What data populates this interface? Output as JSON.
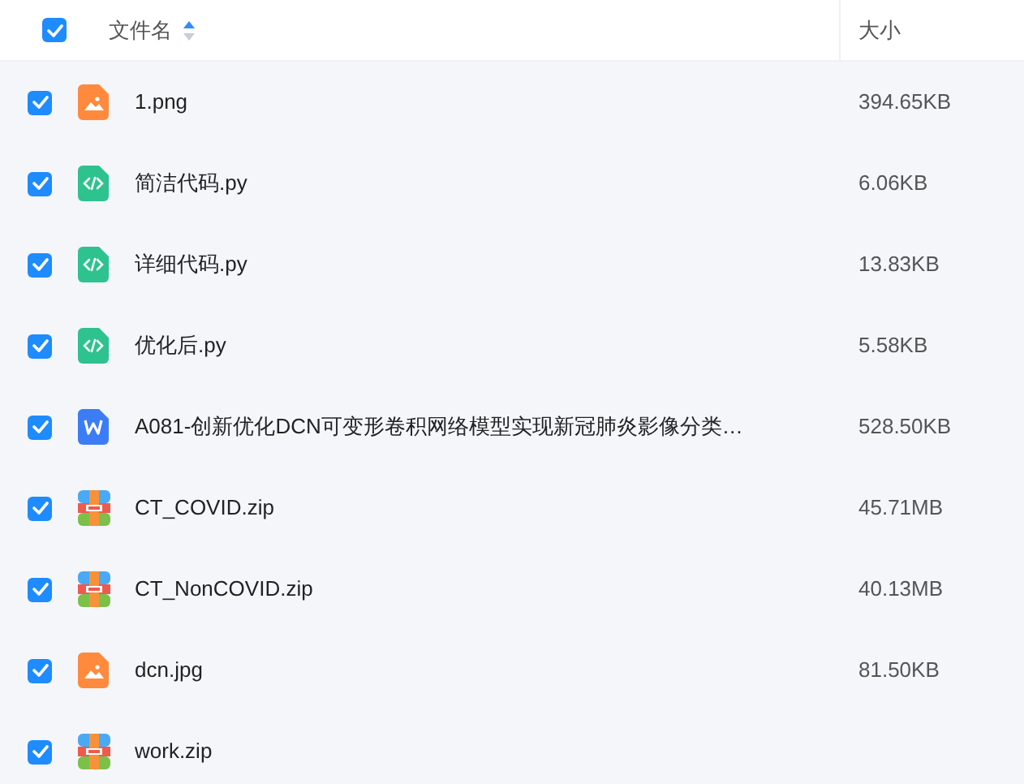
{
  "header": {
    "select_all_checked": true,
    "name_column": "文件名",
    "size_column": "大小"
  },
  "files": [
    {
      "name": "1.png",
      "size": "394.65KB",
      "kind": "image",
      "checked": true
    },
    {
      "name": "简洁代码.py",
      "size": "6.06KB",
      "kind": "code",
      "checked": true
    },
    {
      "name": "详细代码.py",
      "size": "13.83KB",
      "kind": "code",
      "checked": true
    },
    {
      "name": "优化后.py",
      "size": "5.58KB",
      "kind": "code",
      "checked": true
    },
    {
      "name": "A081-创新优化DCN可变形卷积网络模型实现新冠肺炎影像分类…",
      "size": "528.50KB",
      "kind": "doc",
      "checked": true
    },
    {
      "name": "CT_COVID.zip",
      "size": "45.71MB",
      "kind": "zip",
      "checked": true
    },
    {
      "name": "CT_NonCOVID.zip",
      "size": "40.13MB",
      "kind": "zip",
      "checked": true
    },
    {
      "name": "dcn.jpg",
      "size": "81.50KB",
      "kind": "image",
      "checked": true
    },
    {
      "name": "work.zip",
      "kind": "zip",
      "checked": true
    }
  ]
}
